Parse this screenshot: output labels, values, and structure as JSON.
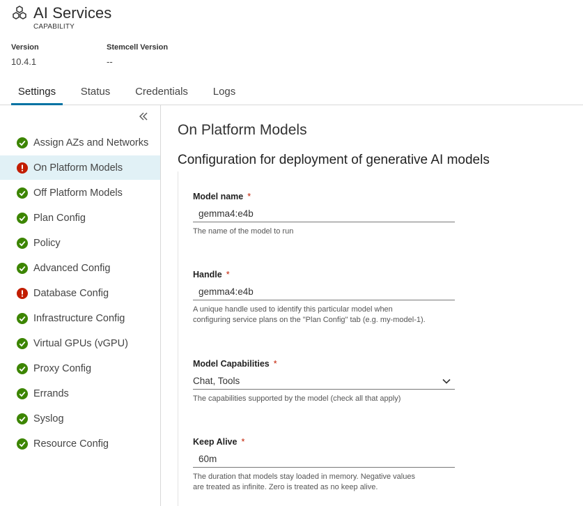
{
  "app": {
    "title": "AI Services",
    "subtitle": "CAPABILITY",
    "icon": "hexagon-cluster-icon"
  },
  "meta": {
    "version_label": "Version",
    "version_value": "10.4.1",
    "stemcell_label": "Stemcell Version",
    "stemcell_value": "--"
  },
  "tabs": [
    {
      "label": "Settings",
      "active": true
    },
    {
      "label": "Status",
      "active": false
    },
    {
      "label": "Credentials",
      "active": false
    },
    {
      "label": "Logs",
      "active": false
    }
  ],
  "sidebar": {
    "collapse_icon": "double-chevron-left-icon",
    "items": [
      {
        "label": "Assign AZs and Networks",
        "status": "ok"
      },
      {
        "label": "On Platform Models",
        "status": "error",
        "active": true
      },
      {
        "label": "Off Platform Models",
        "status": "ok"
      },
      {
        "label": "Plan Config",
        "status": "ok"
      },
      {
        "label": "Policy",
        "status": "ok"
      },
      {
        "label": "Advanced Config",
        "status": "ok"
      },
      {
        "label": "Database Config",
        "status": "error"
      },
      {
        "label": "Infrastructure Config",
        "status": "ok"
      },
      {
        "label": "Virtual GPUs (vGPU)",
        "status": "ok"
      },
      {
        "label": "Proxy Config",
        "status": "ok"
      },
      {
        "label": "Errands",
        "status": "ok"
      },
      {
        "label": "Syslog",
        "status": "ok"
      },
      {
        "label": "Resource Config",
        "status": "ok"
      }
    ]
  },
  "colors": {
    "ok": "#3c8500",
    "error": "#c21d00",
    "accent": "#0072a3",
    "active_bg": "#e1f1f6"
  },
  "main": {
    "title": "On Platform Models",
    "subtitle": "Configuration for deployment of generative AI models",
    "fields": [
      {
        "label": "Model name",
        "required": "*",
        "value": "gemma4:e4b",
        "help": "The name of the model to run"
      },
      {
        "label": "Handle",
        "required": "*",
        "value": "gemma4:e4b",
        "help_line1": "A unique handle used to identify this particular model when",
        "help_line2": "configuring service plans on the \"Plan Config\" tab (e.g. my-model-1)."
      },
      {
        "label": "Model Capabilities",
        "required": "*",
        "value": "Chat, Tools",
        "help": "The capabilities supported by the model (check all that apply)"
      },
      {
        "label": "Keep Alive",
        "required": "*",
        "value": "60m",
        "help_line1": "The duration that models stay loaded in memory. Negative values",
        "help_line2": "are treated as infinite. Zero is treated as no keep alive."
      }
    ]
  }
}
